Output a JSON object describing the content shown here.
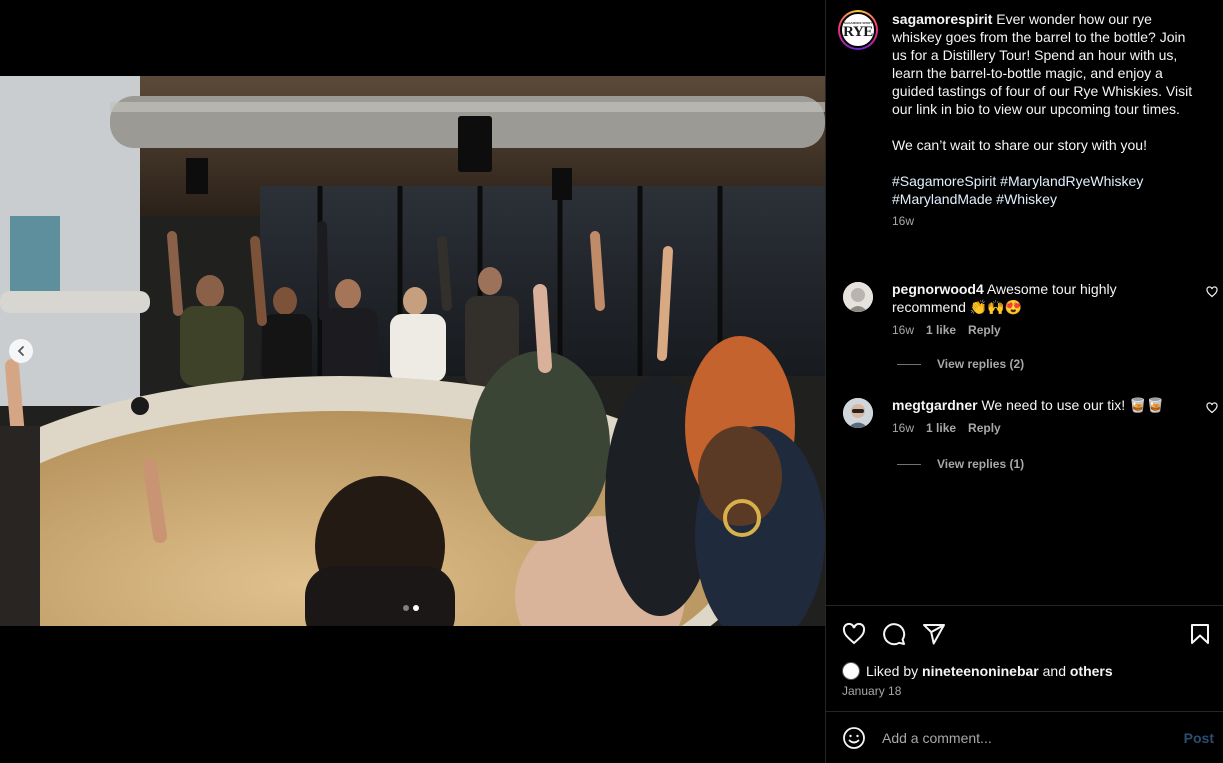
{
  "post": {
    "carousel": {
      "current_index": 2,
      "total": 2
    },
    "author": "sagamorespirit",
    "avatar_text": {
      "small": "SAGAMORE SPIRIT",
      "big": "RYE"
    },
    "caption": {
      "text": "Ever wonder how our rye whiskey goes from the barrel to the bottle? Join us for a Distillery Tour! Spend an hour with us, learn the barrel-to-bottle magic, and enjoy a guided tastings of four of our Rye Whiskies. Visit our link in bio to view our upcoming tour times.",
      "text2": "We can’t wait to share our story with you!",
      "hashtags": [
        "#SagamoreSpirit",
        "#MarylandRyeWhiskey",
        "#MarylandMade",
        "#Whiskey"
      ],
      "time": "16w"
    },
    "comments": [
      {
        "user": "pegnorwood4",
        "text": "Awesome tour highly recommend 👏🙌😍",
        "time": "16w",
        "likes": "1 like",
        "reply": "Reply",
        "view_replies": "View replies (2)"
      },
      {
        "user": "megtgardner",
        "text": "We need to use our tix! 🥃🥃",
        "time": "16w",
        "likes": "1 like",
        "reply": "Reply",
        "view_replies": "View replies (1)"
      }
    ],
    "likes": {
      "prefix": "Liked by",
      "user": "nineteenoninebar",
      "and": "and",
      "others": "others"
    },
    "date": "January 18",
    "add_comment": {
      "placeholder": "Add a comment...",
      "post_label": "Post"
    }
  },
  "icons": {
    "prev": "chevron-left-icon",
    "like": "heart-icon",
    "comment": "comment-bubble-icon",
    "share": "paper-plane-icon",
    "save": "bookmark-icon",
    "emoji": "smiley-icon"
  },
  "colors": {
    "background": "#000000",
    "text": "#f5f5f5",
    "muted": "#a8a8a8",
    "hashtag": "#e0f1ff",
    "post_disabled": "#2c4e6e"
  }
}
